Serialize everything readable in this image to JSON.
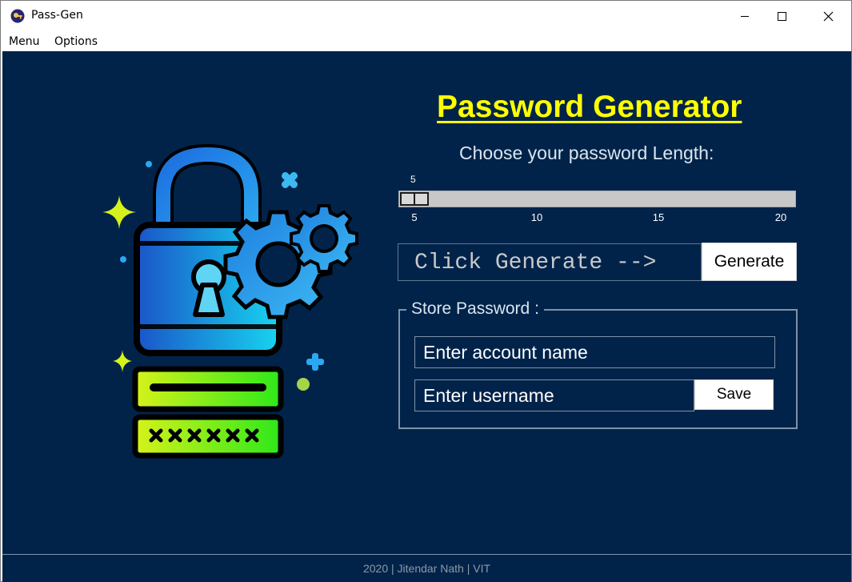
{
  "window": {
    "title": "Pass-Gen"
  },
  "menubar": {
    "items": [
      {
        "label": "Menu"
      },
      {
        "label": "Options"
      }
    ]
  },
  "main": {
    "heading": "Password Generator",
    "subheading": "Choose your password Length:",
    "slider": {
      "value": "5",
      "min": 5,
      "max": 20,
      "ticks": [
        "5",
        "10",
        "15",
        "20"
      ]
    },
    "output_text": "Click Generate -->",
    "generate_label": "Generate",
    "store": {
      "legend": "Store Password :",
      "account_placeholder": "Enter account name",
      "username_placeholder": "Enter username",
      "save_label": "Save"
    }
  },
  "footer": {
    "text": "2020 | Jitendar Nath | VIT"
  },
  "colors": {
    "background": "#01234a",
    "heading": "#ffff00",
    "slider_trough": "#c8c8c8"
  },
  "icons": [
    "app-logo-icon",
    "minimize-icon",
    "maximize-icon",
    "close-icon",
    "padlock-gears-illustration"
  ]
}
